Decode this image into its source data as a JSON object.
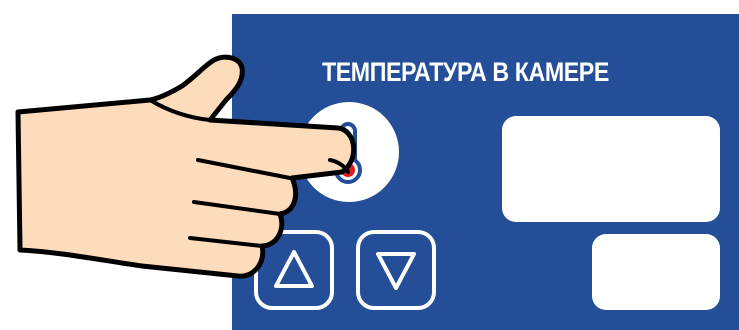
{
  "panel": {
    "title": "ТЕМПЕРАТУРА В КАМЕРЕ",
    "background_color": "#244f98",
    "temperature_button": {
      "icon": "thermometer-icon"
    },
    "up_button": {
      "icon": "triangle-up-icon"
    },
    "down_button": {
      "icon": "triangle-down-icon"
    },
    "main_display": {
      "value": ""
    },
    "secondary_display": {
      "value": ""
    }
  },
  "hand": {
    "icon": "pointing-hand-icon"
  }
}
